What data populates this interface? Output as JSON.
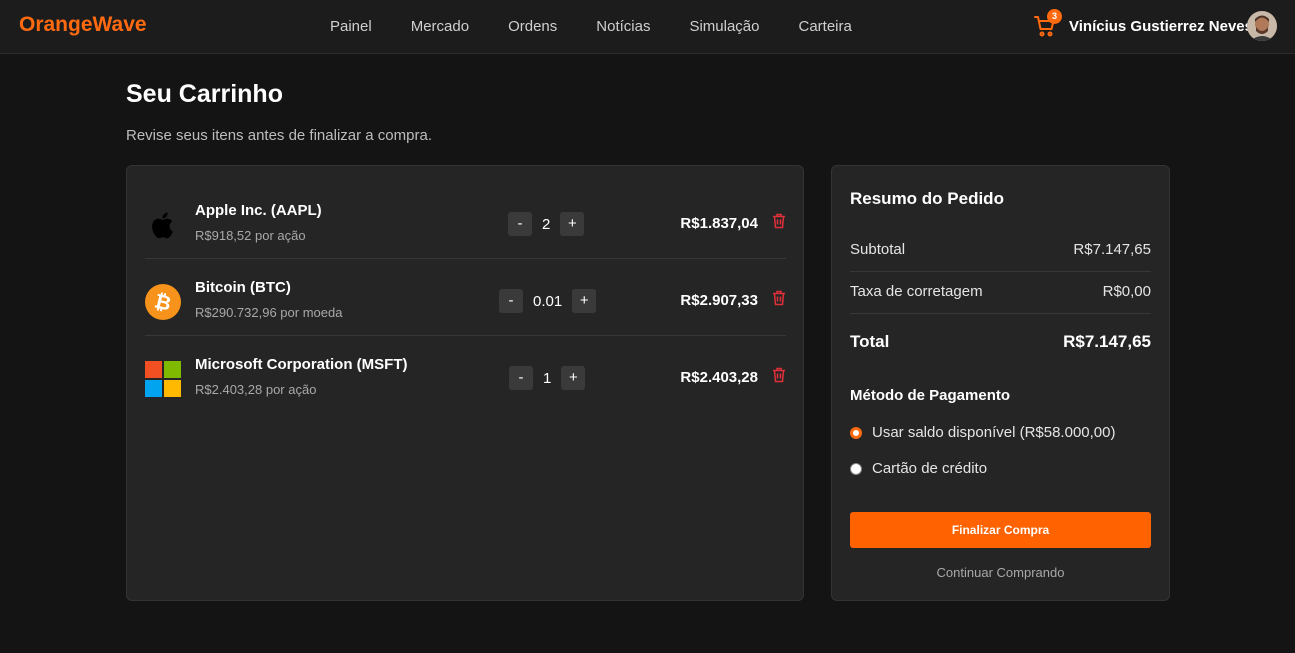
{
  "header": {
    "brand": "OrangeWave",
    "nav": [
      "Painel",
      "Mercado",
      "Ordens",
      "Notícias",
      "Simulação",
      "Carteira"
    ],
    "cart_count": "3",
    "user_name": "Vinícius Gustierrez Neves"
  },
  "page": {
    "title": "Seu Carrinho",
    "subtitle": "Revise seus itens antes de finalizar a compra."
  },
  "items": [
    {
      "name": "Apple Inc. (AAPL)",
      "unit_price": "R$918,52 por ação",
      "qty": "2",
      "total": "R$1.837,04",
      "icon": "apple-logo"
    },
    {
      "name": "Bitcoin (BTC)",
      "unit_price": "R$290.732,96 por moeda",
      "qty": "0.01",
      "total": "R$2.907,33",
      "icon": "bitcoin-logo"
    },
    {
      "name": "Microsoft Corporation (MSFT)",
      "unit_price": "R$2.403,28 por ação",
      "qty": "1",
      "total": "R$2.403,28",
      "icon": "microsoft-logo"
    }
  ],
  "qty_controls": {
    "minus": "-",
    "plus": "+"
  },
  "summary": {
    "title": "Resumo do Pedido",
    "subtotal_label": "Subtotal",
    "subtotal_value": "R$7.147,65",
    "fee_label": "Taxa de corretagem",
    "fee_value": "R$0,00",
    "total_label": "Total",
    "total_value": "R$7.147,65",
    "payment_title": "Método de Pagamento",
    "payment_options": [
      {
        "label": "Usar saldo disponível (R$58.000,00)",
        "selected": true
      },
      {
        "label": "Cartão de crédito",
        "selected": false
      }
    ],
    "finish_label": "Finalizar Compra",
    "continue_label": "Continuar Comprando"
  },
  "colors": {
    "accent": "#ff6a10",
    "danger": "#e0303a",
    "background": "#141414",
    "panel": "#252525"
  }
}
